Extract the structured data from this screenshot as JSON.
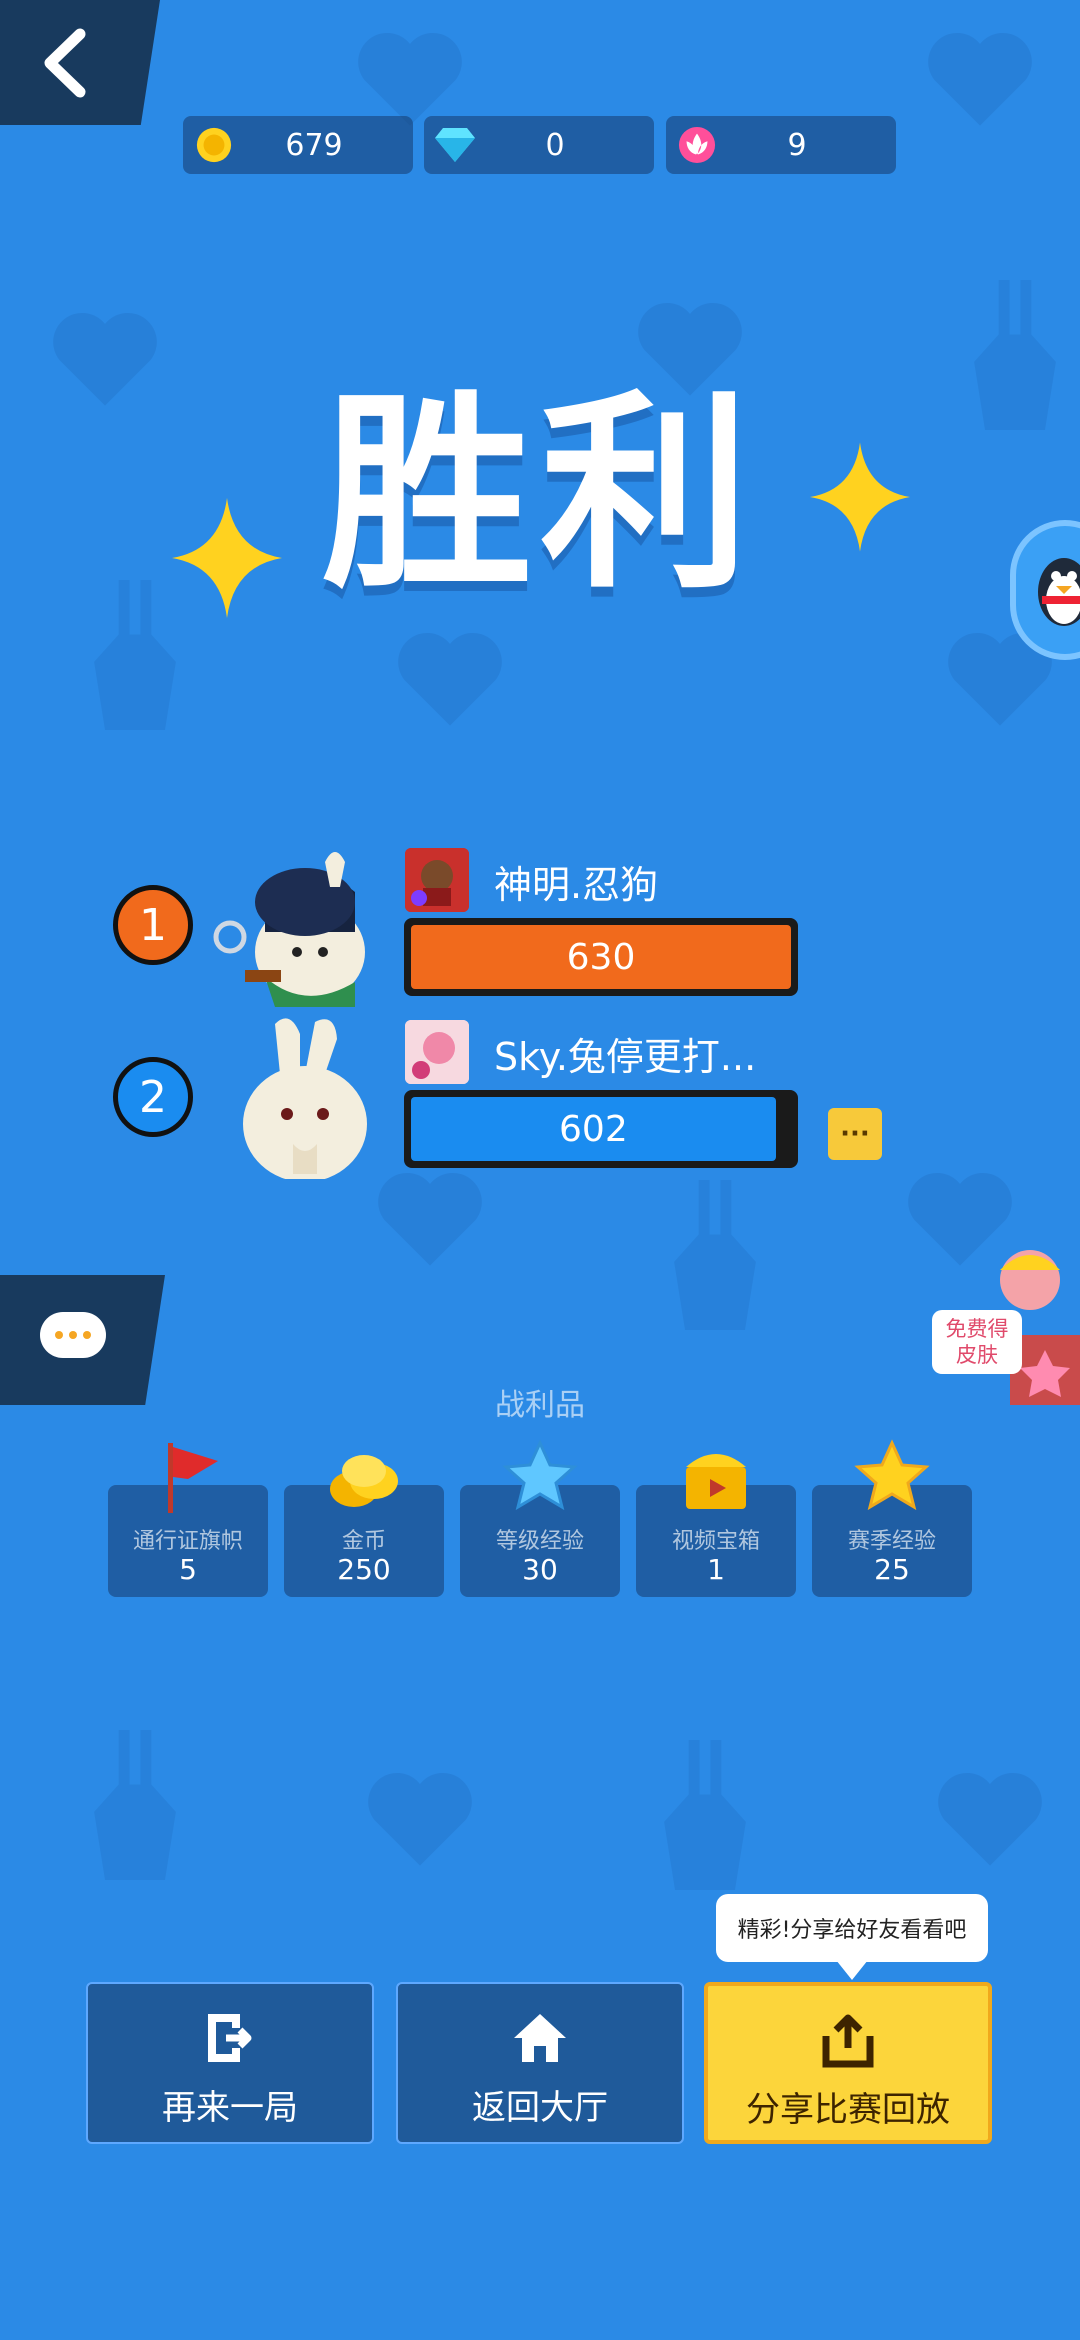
{
  "currencies": [
    {
      "name": "gold-coin-icon",
      "value": "679"
    },
    {
      "name": "diamond-icon",
      "value": "0"
    },
    {
      "name": "lotus-icon",
      "value": "9"
    }
  ],
  "result_title": "胜利",
  "players": [
    {
      "rank": "1",
      "name": "神明.忍狗",
      "score": "630",
      "rank_color": "#f16a1c",
      "bar_color": "#f16a1c"
    },
    {
      "rank": "2",
      "name": "Sky.兔停更打...",
      "score": "602",
      "rank_color": "#1a8cf0",
      "bar_color": "#1a8cf0"
    }
  ],
  "more_label": "···",
  "promo": {
    "line1": "免费得",
    "line2": "皮肤"
  },
  "loot": {
    "title": "战利品",
    "items": [
      {
        "label": "通行证旗帜",
        "value": "5",
        "icon": "red-flag-icon"
      },
      {
        "label": "金币",
        "value": "250",
        "icon": "gold-coins-icon"
      },
      {
        "label": "等级经验",
        "value": "30",
        "icon": "blue-star-icon"
      },
      {
        "label": "视频宝箱",
        "value": "1",
        "icon": "video-chest-icon"
      },
      {
        "label": "赛季经验",
        "value": "25",
        "icon": "gold-star-icon"
      }
    ]
  },
  "buttons": {
    "again": "再来一局",
    "lobby": "返回大厅",
    "share": "分享比赛回放"
  },
  "tooltip": "精彩!分享给好友看看吧"
}
